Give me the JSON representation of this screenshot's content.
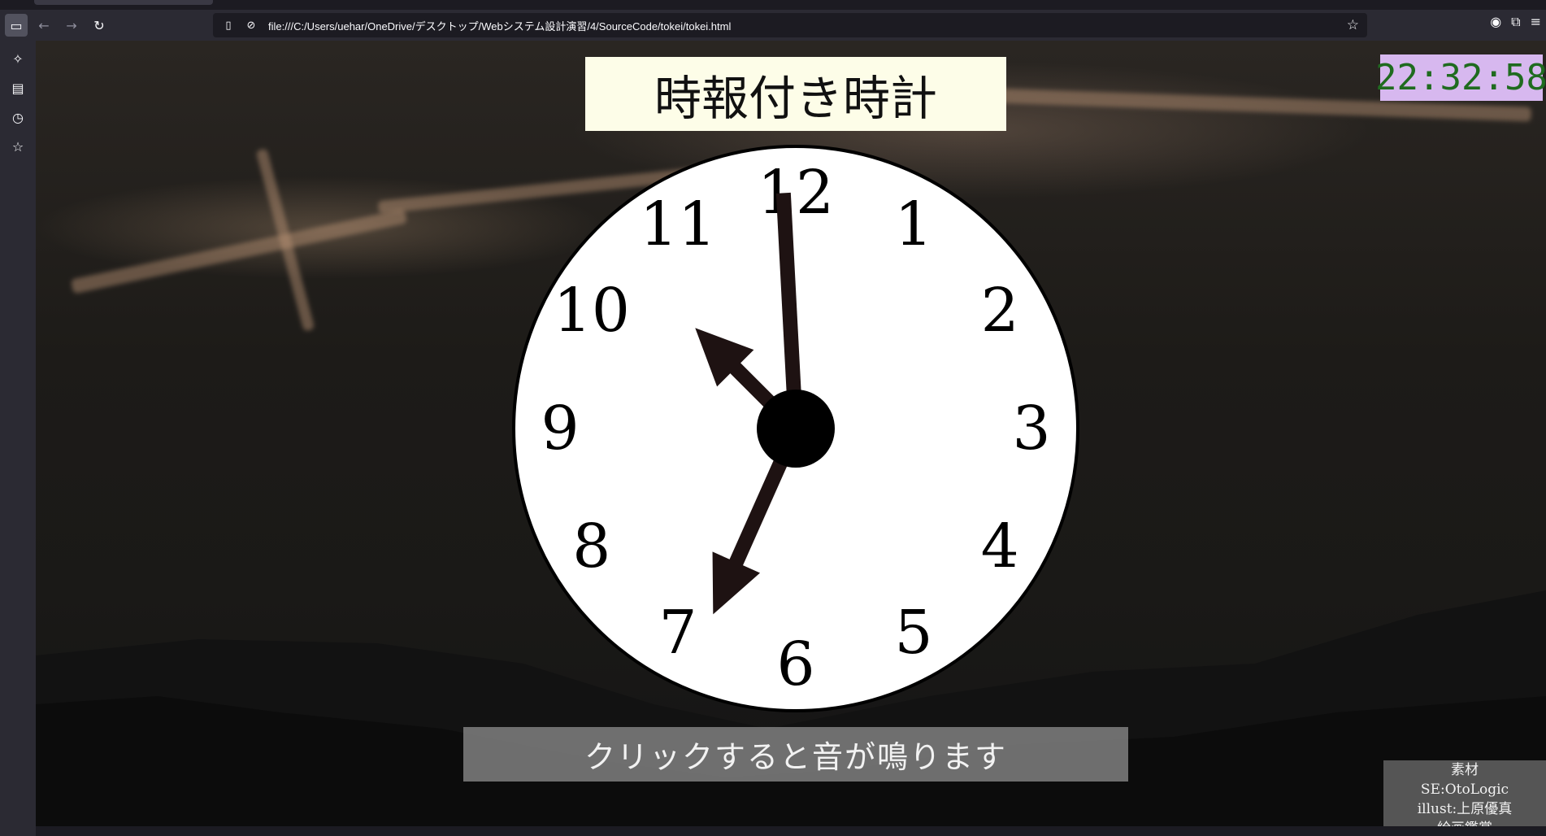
{
  "browser": {
    "url": "file:///C:/Users/uehar/OneDrive/デスクトップ/Webシステム設計演習/4/SourceCode/tokei/tokei.html"
  },
  "page": {
    "title": "時報付き時計",
    "digital_time": "22:32:58",
    "click_message": "クリックすると音が鳴ります",
    "credits": {
      "heading": "素材",
      "se": "SE:OtoLogic",
      "illust": "illust:上原優真",
      "extra": "絵画鑑賞"
    }
  },
  "clock": {
    "numbers": [
      "12",
      "1",
      "2",
      "3",
      "4",
      "5",
      "6",
      "7",
      "8",
      "9",
      "10",
      "11"
    ],
    "hour": 10.5,
    "minute": 59.5,
    "second": 34,
    "face_color": "#ffffff",
    "hand_color": "#1e1212"
  },
  "colors": {
    "title_bg": "#fdfde8",
    "digital_bg": "#d7b8ef",
    "digital_text": "#1f6b1f"
  }
}
